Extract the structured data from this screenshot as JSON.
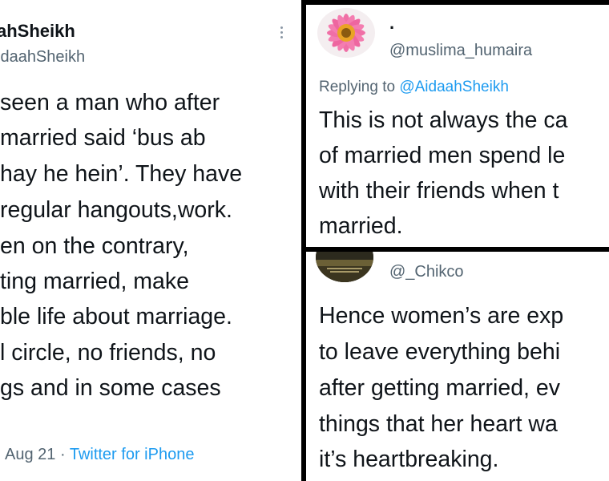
{
  "left_tweet": {
    "display_name": "ahSheikh",
    "handle": "idaahSheikh",
    "body_lines": [
      "seen a man who after",
      "married said ‘bus ab",
      "hay he hein’. They have",
      "regular hangouts,work.",
      "en on the contrary,",
      "ting married, make",
      "ble life about marriage.",
      "l circle, no friends, no",
      "gs and in some cases"
    ],
    "date": "Aug 21 · ",
    "source": "Twitter for iPhone"
  },
  "reply_tweet_1": {
    "display_name": ".",
    "handle": "@muslima_humaira",
    "replying_prefix": "Replying to ",
    "replying_mention": "@AidaahSheikh",
    "body_lines": [
      "This is not always the ca",
      "of married men spend le",
      "with their friends when t",
      "married."
    ]
  },
  "reply_tweet_2": {
    "handle": "@_Chikco",
    "body_lines": [
      "Hence women’s are exp",
      "to leave everything behi",
      "after getting married, ev",
      "things that her heart wa",
      "it’s heartbreaking."
    ]
  },
  "icons": {
    "more": "more-options-icon",
    "avatar_1": "pink-flower-avatar",
    "avatar_2": "landscape-avatar"
  },
  "colors": {
    "link": "#1d9bf0",
    "secondary_text": "#536471",
    "primary_text": "#0f1419",
    "separator": "#000000"
  }
}
